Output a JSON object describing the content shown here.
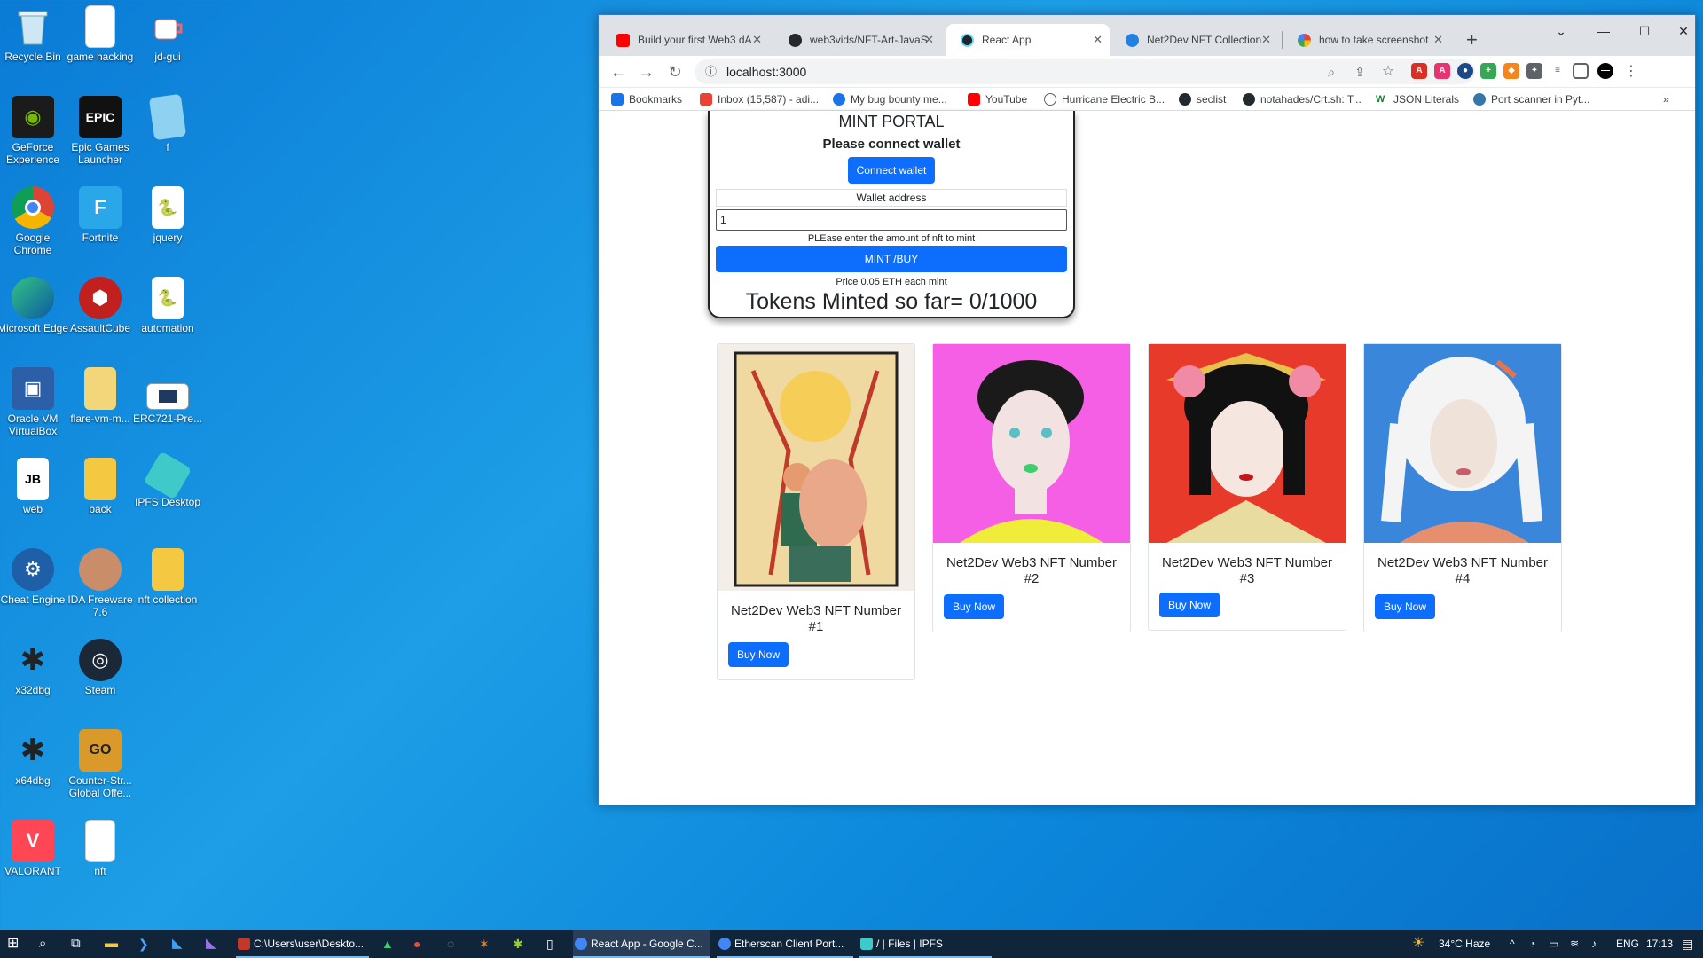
{
  "desktop": {
    "icons": [
      {
        "label": "Recycle Bin",
        "icon": "recycle-bin-icon"
      },
      {
        "label": "game hacking",
        "icon": "document-icon"
      },
      {
        "label": "jd-gui",
        "icon": "java-cup-icon"
      },
      {
        "label": "GeForce Experience",
        "icon": "nvidia-icon"
      },
      {
        "label": "Epic Games Launcher",
        "icon": "epic-games-icon"
      },
      {
        "label": "f",
        "icon": "notepad-icon"
      },
      {
        "label": "Google Chrome",
        "icon": "chrome-icon"
      },
      {
        "label": "Fortnite",
        "icon": "fortnite-icon"
      },
      {
        "label": "jquery",
        "icon": "python-file-icon"
      },
      {
        "label": "Microsoft Edge",
        "icon": "edge-icon"
      },
      {
        "label": "AssaultCube",
        "icon": "assaultcube-icon"
      },
      {
        "label": "automation",
        "icon": "python-file-icon"
      },
      {
        "label": "Oracle VM VirtualBox",
        "icon": "virtualbox-icon"
      },
      {
        "label": "flare-vm-m...",
        "icon": "zip-folder-icon"
      },
      {
        "label": "ERC721-Pre...",
        "icon": "image-file-icon"
      },
      {
        "label": "web",
        "icon": "jetbrains-icon"
      },
      {
        "label": "back",
        "icon": "folder-icon"
      },
      {
        "label": "IPFS Desktop",
        "icon": "ipfs-icon"
      },
      {
        "label": "Cheat Engine",
        "icon": "cheat-engine-icon"
      },
      {
        "label": "IDA Freeware 7.6",
        "icon": "ida-icon"
      },
      {
        "label": "nft collection",
        "icon": "folder-icon"
      },
      {
        "label": "x32dbg",
        "icon": "bug-icon"
      },
      {
        "label": "Steam",
        "icon": "steam-icon"
      },
      {
        "label": "x64dbg",
        "icon": "bug-icon"
      },
      {
        "label": "Counter-Str... Global Offe...",
        "icon": "csgo-icon"
      },
      {
        "label": "VALORANT",
        "icon": "valorant-icon"
      },
      {
        "label": "nft",
        "icon": "blank-file-icon"
      }
    ]
  },
  "browser": {
    "tabs": [
      {
        "label": "Build your first Web3 dA",
        "icon": "youtube-icon",
        "color": "#ff0000",
        "active": false
      },
      {
        "label": "web3vids/NFT-Art-JavaS",
        "icon": "github-icon",
        "color": "#24292e",
        "active": false
      },
      {
        "label": "React App",
        "icon": "react-icon",
        "color": "#20232a",
        "active": true
      },
      {
        "label": "Net2Dev NFT Collection",
        "icon": "opensea-icon",
        "color": "#2081e2",
        "active": false
      },
      {
        "label": "how to take screenshot",
        "icon": "google-icon",
        "color": "#4285f4",
        "active": false
      }
    ],
    "url": "localhost:3000",
    "bookmarks": [
      {
        "label": "Bookmarks",
        "icon": "star-icon",
        "color": "#1a73e8"
      },
      {
        "label": "Inbox (15,587) - adi...",
        "icon": "gmail-icon",
        "color": "#ea4335"
      },
      {
        "label": "My bug bounty me...",
        "icon": "bookmark-site-icon",
        "color": "#1a73e8"
      },
      {
        "label": "YouTube",
        "icon": "youtube-icon",
        "color": "#ff0000"
      },
      {
        "label": "Hurricane Electric B...",
        "icon": "he-icon",
        "color": "#5f6368"
      },
      {
        "label": "seclist",
        "icon": "github-icon",
        "color": "#24292e"
      },
      {
        "label": "notahades/Crt.sh: T...",
        "icon": "github-icon",
        "color": "#24292e"
      },
      {
        "label": "JSON Literals",
        "icon": "w-icon",
        "color": "#3c4043"
      },
      {
        "label": "Port scanner in Pyt...",
        "icon": "python-icon",
        "color": "#3776ab"
      }
    ]
  },
  "mint": {
    "title": "MINT PORTAL",
    "subtitle": "Please connect wallet",
    "connect_label": "Connect wallet",
    "wallet_label": "Wallet address",
    "amount_value": "1",
    "amount_hint": "PLEase enter the amount of nft to mint",
    "mint_label": "MINT /BUY",
    "price": "Price 0.05 ETH each mint",
    "minted": "Tokens Minted so far= 0/1000"
  },
  "nfts": [
    {
      "name": "Net2Dev Web3 NFT Number #1",
      "buy": "Buy Now",
      "bg": "#f0d9a0"
    },
    {
      "name": "Net2Dev Web3 NFT Number #2",
      "buy": "Buy Now",
      "bg": "#f55fe6"
    },
    {
      "name": "Net2Dev Web3 NFT Number #3",
      "buy": "Buy Now",
      "bg": "#e83a2a"
    },
    {
      "name": "Net2Dev Web3 NFT Number #4",
      "buy": "Buy Now",
      "bg": "#3a86db"
    }
  ],
  "taskbar": {
    "apps": [
      {
        "label": "C:\\Users\\user\\Deskto...",
        "icon": "terminal-icon"
      },
      {
        "label": "React App - Google C...",
        "icon": "chrome-icon"
      },
      {
        "label": "Etherscan Client Port...",
        "icon": "chrome-icon"
      },
      {
        "label": "/ | Files | IPFS",
        "icon": "ipfs-icon"
      }
    ],
    "weather": "34°C  Haze",
    "language": "ENG",
    "time": "17:13"
  }
}
